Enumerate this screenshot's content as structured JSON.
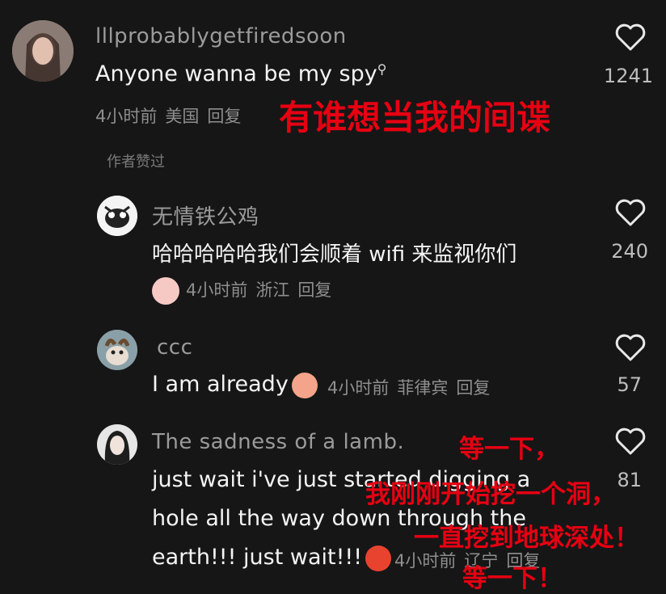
{
  "comments": [
    {
      "username": "lllprobablygetfiredsoon",
      "text": "Anyone wanna be my spy",
      "search_icon": "search-icon",
      "time": "4小时前",
      "location": "美国",
      "reply": "回复",
      "likes": "1241"
    },
    {
      "username": "无情铁公鸡",
      "text": "哈哈哈哈哈我们会顺着 wifi 来监视你们",
      "time": "4小时前",
      "location": "浙江",
      "reply": "回复",
      "likes": "240"
    },
    {
      "username": "ccc",
      "text": "I am already",
      "time": "4小时前",
      "location": "菲律宾",
      "reply": "回复",
      "likes": "57"
    },
    {
      "username": "The sadness of a lamb.",
      "text_line1": "just wait i've just started digging a",
      "text_line2": "hole all the way down through the",
      "text_line3": "earth!!! just wait!!!",
      "time": "4小时前",
      "location": "辽宁",
      "reply": "回复",
      "likes": "81"
    }
  ],
  "author_liked": "作者赞过",
  "overlays": {
    "translation1": "有谁想当我的间谍",
    "translation2_line1": "等一下，",
    "translation2_line2": "我刚刚开始挖一个洞，",
    "translation2_line3": "一直挖到地球深处！",
    "translation2_line4": "等一下！"
  },
  "colors": {
    "background": "#161616",
    "overlay_red": "#e60012",
    "username_gray": "#9b9b9b"
  }
}
